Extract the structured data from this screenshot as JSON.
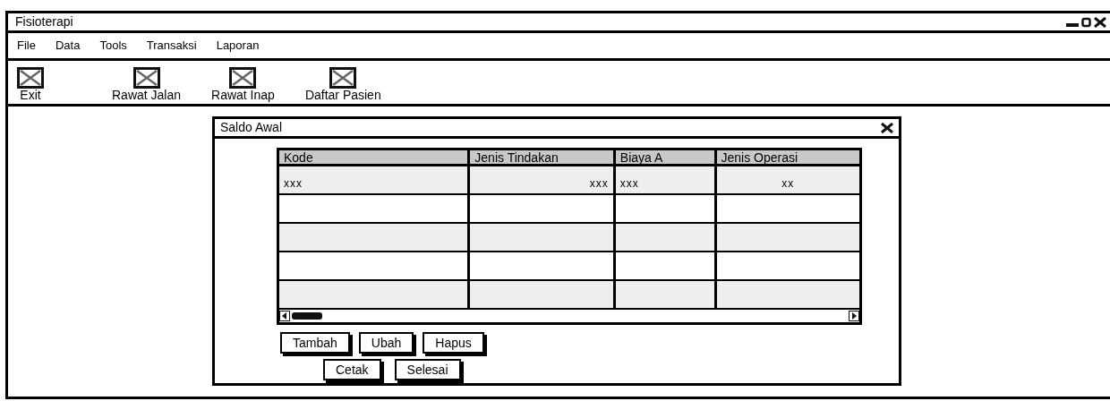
{
  "window": {
    "title": "Fisioterapi"
  },
  "menu": [
    {
      "label": "File"
    },
    {
      "label": "Data"
    },
    {
      "label": "Tools"
    },
    {
      "label": "Transaksi"
    },
    {
      "label": "Laporan"
    }
  ],
  "toolbar": [
    {
      "label": "Exit"
    },
    {
      "label": "Rawat Jalan"
    },
    {
      "label": "Rawat Inap"
    },
    {
      "label": "Daftar Pasien"
    }
  ],
  "dialog": {
    "title": "Saldo Awal",
    "table": {
      "columns": [
        {
          "label": "Kode",
          "kind": "left"
        },
        {
          "label": "Jenis Tindakan",
          "kind": "right"
        },
        {
          "label": "Biaya A",
          "kind": "left"
        },
        {
          "label": "Jenis Operasi",
          "kind": "center"
        }
      ],
      "rows": [
        {
          "kind": "filled",
          "cells": [
            "xxx",
            "xxx",
            "xxx",
            "xx"
          ]
        },
        {
          "kind": "empty"
        },
        {
          "kind": "empty"
        },
        {
          "kind": "empty"
        },
        {
          "kind": "empty"
        }
      ]
    },
    "buttons": [
      [
        "Tambah",
        "Ubah",
        "Hapus"
      ],
      [
        "Cetak",
        "Selesai"
      ]
    ]
  }
}
